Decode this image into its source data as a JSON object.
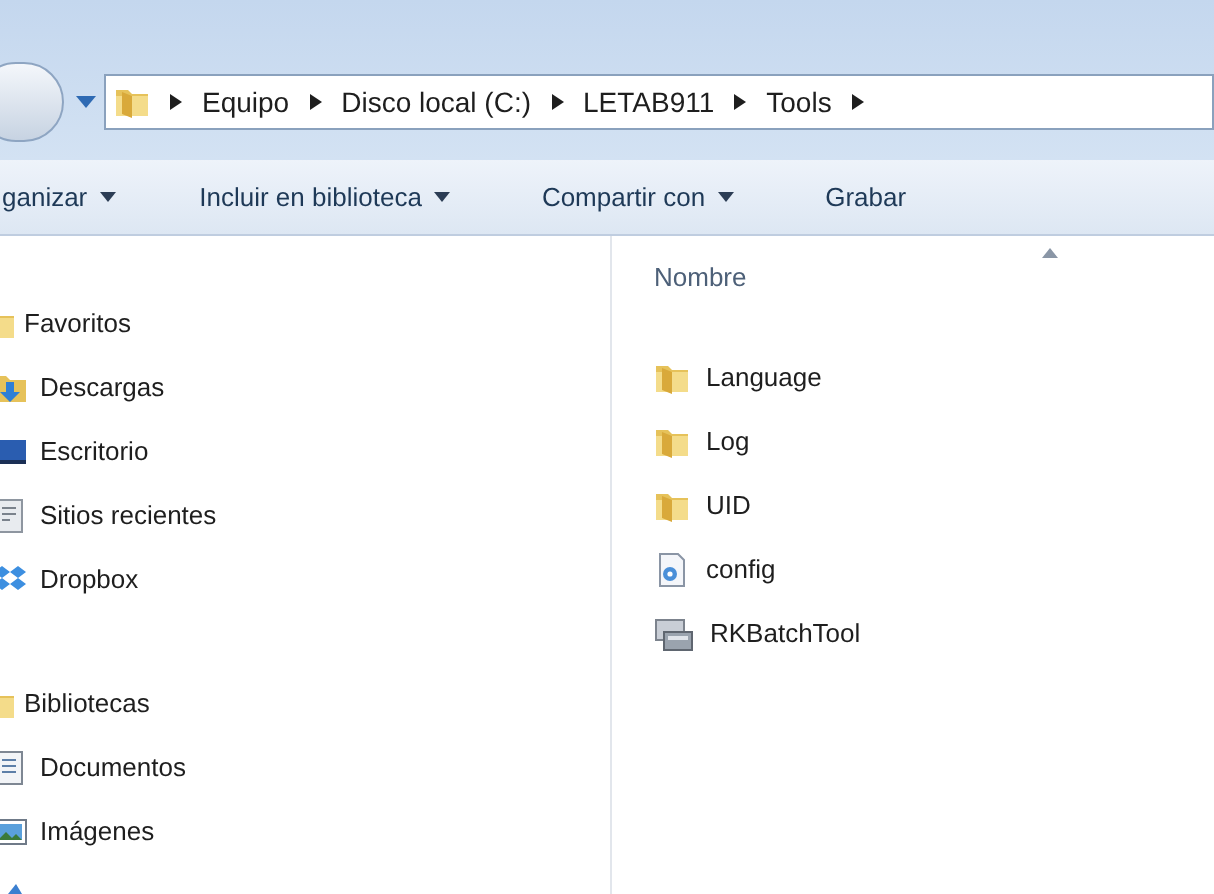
{
  "address_bar": {
    "crumbs": [
      "Equipo",
      "Disco local (C:)",
      "LETAB911",
      "Tools"
    ]
  },
  "toolbar": [
    {
      "label": "ganizar",
      "dropdown": true
    },
    {
      "label": "Incluir en biblioteca",
      "dropdown": true
    },
    {
      "label": "Compartir con",
      "dropdown": true
    },
    {
      "label": "Grabar",
      "dropdown": false
    }
  ],
  "nav_pane": {
    "groups": [
      {
        "label": "Favoritos",
        "items": [
          {
            "label": "Descargas",
            "kind": "downloads"
          },
          {
            "label": "Escritorio",
            "kind": "desktop"
          },
          {
            "label": "Sitios recientes",
            "kind": "recent"
          },
          {
            "label": "Dropbox",
            "kind": "dropbox"
          }
        ]
      },
      {
        "label": "Bibliotecas",
        "items": [
          {
            "label": "Documentos",
            "kind": "documents"
          },
          {
            "label": "Imágenes",
            "kind": "pictures"
          }
        ]
      }
    ]
  },
  "file_list": {
    "column": "Nombre",
    "items": [
      {
        "name": "Language",
        "kind": "folder"
      },
      {
        "name": "Log",
        "kind": "folder"
      },
      {
        "name": "UID",
        "kind": "folder"
      },
      {
        "name": "config",
        "kind": "config"
      },
      {
        "name": "RKBatchTool",
        "kind": "app"
      }
    ]
  }
}
